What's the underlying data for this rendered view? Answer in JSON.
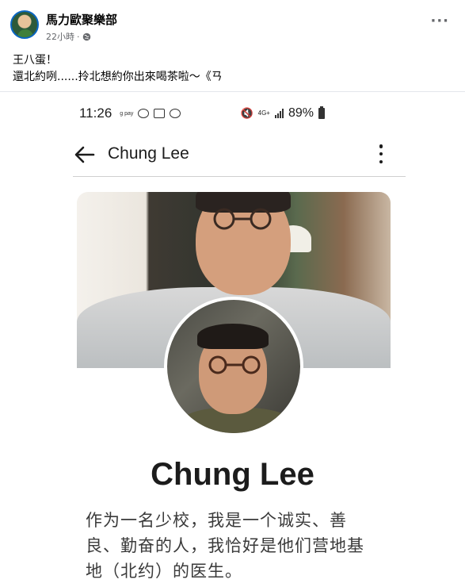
{
  "post": {
    "page_name": "馬力歐聚樂部",
    "time": "22小時",
    "text_lines": [
      "王八蛋！",
      "還北約咧......拎北想約你出來喝茶啦～《ㄢ"
    ]
  },
  "screenshot": {
    "status_bar": {
      "time": "11:26",
      "battery": "89%",
      "network": "4G+",
      "pay_label": "g pay"
    },
    "app_bar": {
      "title": "Chung Lee"
    },
    "profile": {
      "name": "Chung Lee",
      "bio_lines": [
        "作为一名少校，我是一个诚实、善",
        "良、勤奋的人，我恰好是他们营地基",
        "地（北约）的医生。"
      ]
    }
  },
  "icons": [
    "globe-icon",
    "more-icon",
    "back-icon",
    "kebab-icon",
    "mute-icon",
    "signal-icon",
    "battery-icon"
  ]
}
